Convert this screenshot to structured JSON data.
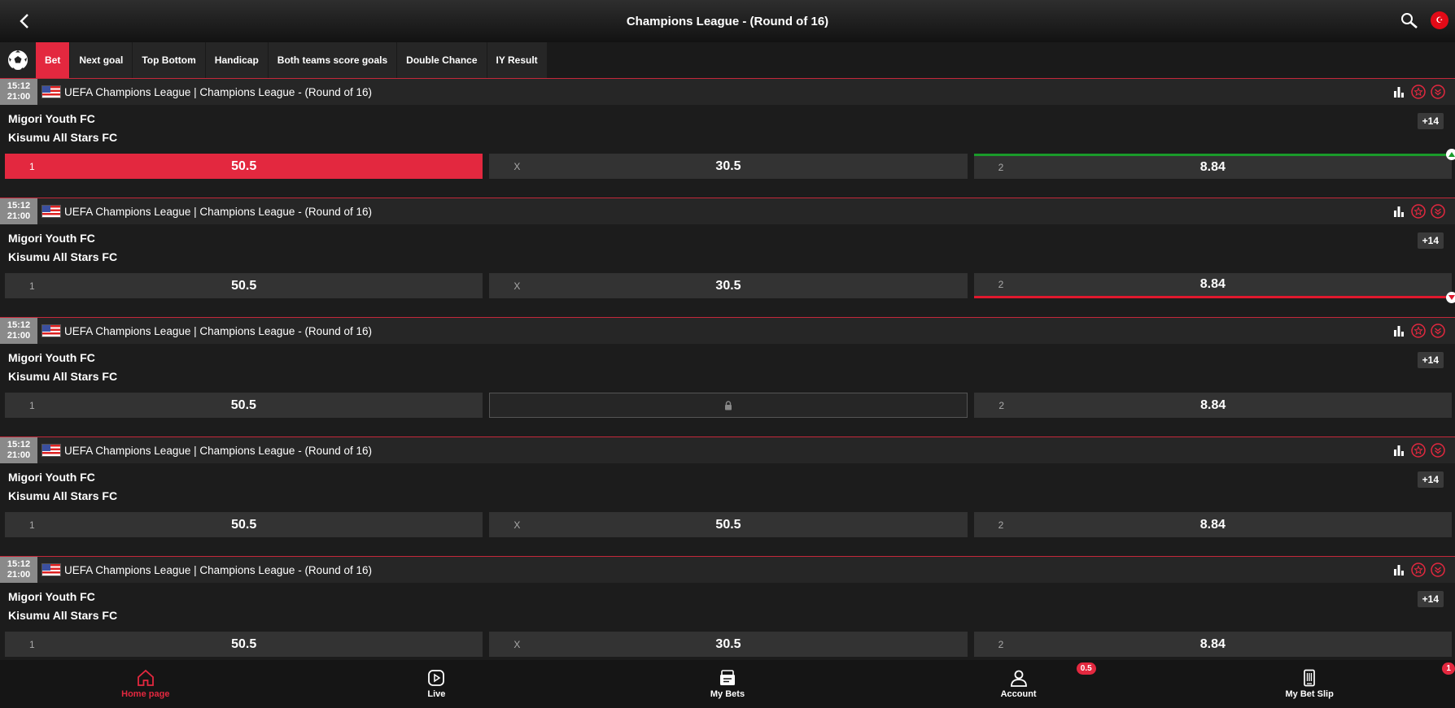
{
  "header": {
    "title": "Champions League - (Round of 16)"
  },
  "tabs": [
    {
      "label": "Bet",
      "active": true
    },
    {
      "label": "Next goal"
    },
    {
      "label": "Top Bottom"
    },
    {
      "label": "Handicap"
    },
    {
      "label": "Both teams score goals"
    },
    {
      "label": "Double Chance"
    },
    {
      "label": "IY Result"
    }
  ],
  "events": [
    {
      "time1": "15:12",
      "time2": "21:00",
      "league": "UEFA Champions League | Champions League - (Round of 16)",
      "home": "Migori Youth FC",
      "away": "Kisumu All Stars FC",
      "more": "+14",
      "odds": [
        {
          "label": "1",
          "value": "50.5"
        },
        {
          "label": "X",
          "value": "30.5"
        },
        {
          "label": "2",
          "value": "8.84"
        }
      ]
    },
    {
      "time1": "15:12",
      "time2": "21:00",
      "league": "UEFA Champions League | Champions League - (Round of 16)",
      "home": "Migori Youth FC",
      "away": "Kisumu All Stars FC",
      "more": "+14",
      "odds": [
        {
          "label": "1",
          "value": "50.5"
        },
        {
          "label": "X",
          "value": "30.5"
        },
        {
          "label": "2",
          "value": "8.84"
        }
      ]
    },
    {
      "time1": "15:12",
      "time2": "21:00",
      "league": "UEFA Champions League | Champions League - (Round of 16)",
      "home": "Migori Youth FC",
      "away": "Kisumu All Stars FC",
      "more": "+14",
      "odds": [
        {
          "label": "1",
          "value": "50.5"
        },
        {
          "label": "",
          "value": ""
        },
        {
          "label": "2",
          "value": "8.84"
        }
      ]
    },
    {
      "time1": "15:12",
      "time2": "21:00",
      "league": "UEFA Champions League | Champions League - (Round of 16)",
      "home": "Migori Youth FC",
      "away": "Kisumu All Stars FC",
      "more": "+14",
      "odds": [
        {
          "label": "1",
          "value": "50.5"
        },
        {
          "label": "X",
          "value": "50.5"
        },
        {
          "label": "2",
          "value": "8.84"
        }
      ]
    },
    {
      "time1": "15:12",
      "time2": "21:00",
      "league": "UEFA Champions League | Champions League - (Round of 16)",
      "home": "Migori Youth FC",
      "away": "Kisumu All Stars FC",
      "more": "+14",
      "odds": [
        {
          "label": "1",
          "value": "50.5"
        },
        {
          "label": "X",
          "value": "30.5"
        },
        {
          "label": "2",
          "value": "8.84"
        }
      ]
    }
  ],
  "nav": [
    {
      "label": "Home page"
    },
    {
      "label": "Live"
    },
    {
      "label": "My Bets"
    },
    {
      "label": "Account",
      "badge": "0.5"
    },
    {
      "label": "My Bet Slip",
      "badge": "1"
    }
  ],
  "colors": {
    "accent": "#e3283f",
    "up": "#1a9b2a",
    "down": "#e0182d"
  }
}
